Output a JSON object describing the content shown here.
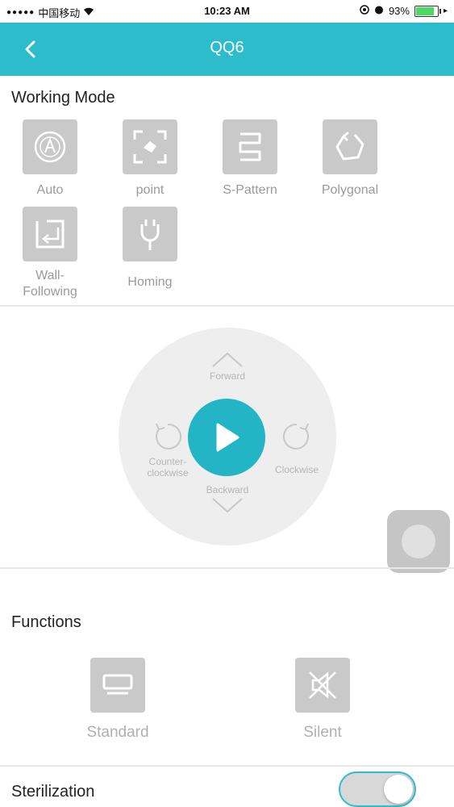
{
  "status_bar": {
    "carrier": "中国移动",
    "time": "10:23 AM",
    "battery_percent": "93%",
    "battery_level": 0.93
  },
  "header": {
    "title": "QQ6"
  },
  "working_mode": {
    "title": "Working Mode",
    "modes": [
      {
        "label": "Auto",
        "icon": "auto-icon"
      },
      {
        "label": "point",
        "icon": "point-icon"
      },
      {
        "label": "S-Pattern",
        "icon": "s-pattern-icon"
      },
      {
        "label": "Polygonal",
        "icon": "polygonal-icon"
      },
      {
        "label": "Wall-\nFollowing",
        "icon": "wall-following-icon"
      },
      {
        "label": "Homing",
        "icon": "homing-icon"
      }
    ]
  },
  "controls": {
    "forward": "Forward",
    "backward": "Backward",
    "counterclockwise": "Counter-\nclockwise",
    "clockwise": "Clockwise"
  },
  "functions": {
    "title": "Functions",
    "items": [
      {
        "label": "Standard",
        "icon": "standard-icon"
      },
      {
        "label": "Silent",
        "icon": "silent-icon"
      }
    ]
  },
  "sterilization": {
    "title": "Sterilization",
    "enabled": true
  },
  "colors": {
    "accent": "#2dbccc",
    "play": "#23b5c6",
    "tile": "#c9c9c9"
  }
}
